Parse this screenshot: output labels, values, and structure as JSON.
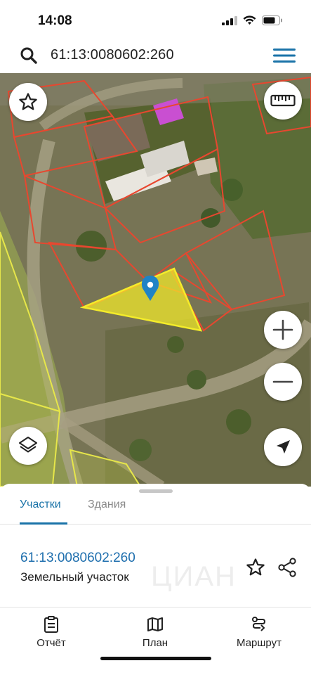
{
  "status_bar": {
    "time": "14:08"
  },
  "search": {
    "query": "61:13:0080602:260"
  },
  "map": {
    "selected_parcel_color": "#f4ec2a",
    "parcel_outline_color": "#e8472f"
  },
  "bottom_sheet": {
    "tabs": [
      {
        "label": "Участки",
        "active": true
      },
      {
        "label": "Здания",
        "active": false
      }
    ],
    "item": {
      "cadastral_number": "61:13:0080602:260",
      "type": "Земельный участок",
      "watermark": "ЦИАН"
    }
  },
  "nav": {
    "items": [
      {
        "label": "Отчёт",
        "icon": "report-icon"
      },
      {
        "label": "План",
        "icon": "map-plan-icon"
      },
      {
        "label": "Маршрут",
        "icon": "route-icon"
      }
    ]
  },
  "colors": {
    "accent": "#1a73a8",
    "link": "#1f6fae"
  }
}
